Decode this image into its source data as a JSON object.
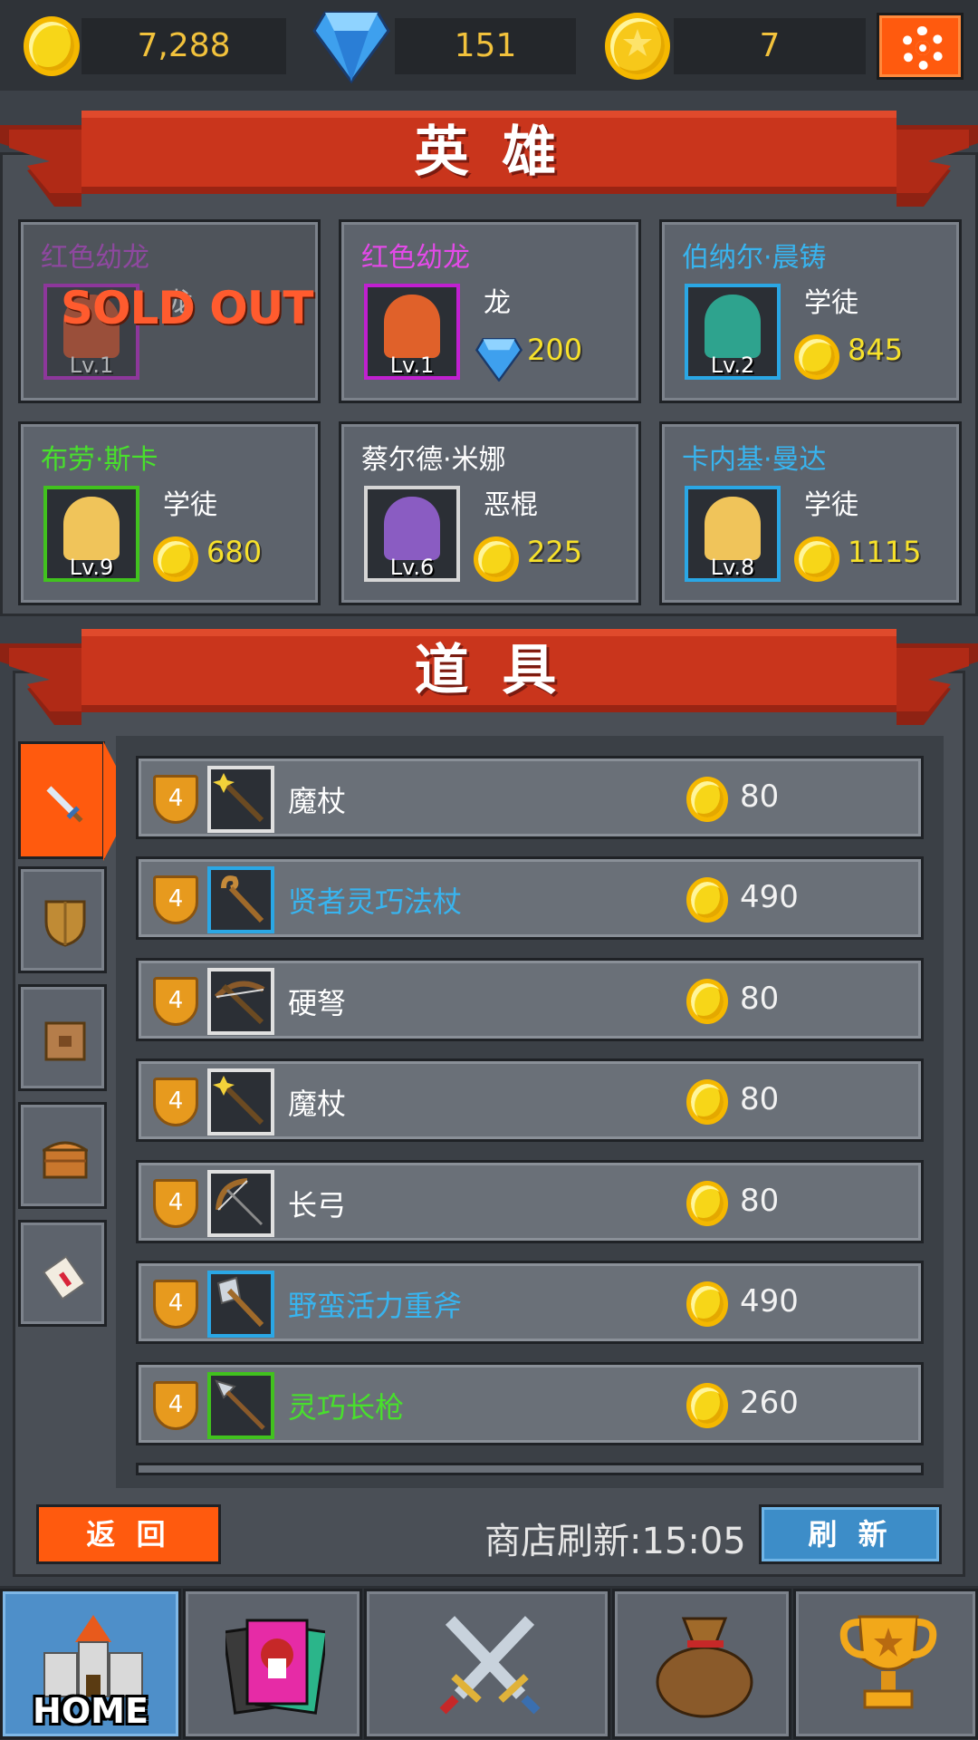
{
  "resources": {
    "gold": "7,288",
    "gems": "151",
    "medals": "7"
  },
  "sections": {
    "heroes_title": "英 雄",
    "items_title": "道 具"
  },
  "heroes": [
    {
      "name": "红色幼龙",
      "name_color": "#c23fd8",
      "class": "龙",
      "level": "Lv.1",
      "currency": "gem",
      "price": "",
      "sold_out": true,
      "sold_out_label": "SOLD OUT",
      "frame": "#c020d0",
      "art": "#d84c20"
    },
    {
      "name": "红色幼龙",
      "name_color": "#e34ae8",
      "class": "龙",
      "level": "Lv.1",
      "currency": "gem",
      "price": "200",
      "sold_out": false,
      "frame": "#c020d0",
      "art": "#e0612a"
    },
    {
      "name": "伯纳尔·晨铸",
      "name_color": "#38b4ef",
      "class": "学徒",
      "level": "Lv.2",
      "currency": "gold",
      "price": "845",
      "sold_out": false,
      "frame": "#2aa7e5",
      "art": "#2ea38e"
    },
    {
      "name": "布劳·斯卡",
      "name_color": "#48e02c",
      "class": "学徒",
      "level": "Lv.9",
      "currency": "gold",
      "price": "680",
      "sold_out": false,
      "frame": "#41c21e",
      "art": "#f0c45a"
    },
    {
      "name": "蔡尔德·米娜",
      "name_color": "#ffffff",
      "class": "恶棍",
      "level": "Lv.6",
      "currency": "gold",
      "price": "225",
      "sold_out": false,
      "frame": "#d6d6d6",
      "art": "#8a5cc2"
    },
    {
      "name": "卡内基·曼达",
      "name_color": "#38b4ef",
      "class": "学徒",
      "level": "Lv.8",
      "currency": "gold",
      "price": "1115",
      "sold_out": false,
      "frame": "#2aa7e5",
      "art": "#f0c45a"
    }
  ],
  "items": [
    {
      "tier": "4",
      "name": "魔杖",
      "name_color": "#ffffff",
      "frame": "#e0e0e0",
      "icon": "wand-icon",
      "price": "80"
    },
    {
      "tier": "4",
      "name": "贤者灵巧法杖",
      "name_color": "#38b4ef",
      "frame": "#2aa7e5",
      "icon": "staff-icon",
      "price": "490"
    },
    {
      "tier": "4",
      "name": "硬弩",
      "name_color": "#ffffff",
      "frame": "#e0e0e0",
      "icon": "crossbow-icon",
      "price": "80"
    },
    {
      "tier": "4",
      "name": "魔杖",
      "name_color": "#ffffff",
      "frame": "#e0e0e0",
      "icon": "wand-icon",
      "price": "80"
    },
    {
      "tier": "4",
      "name": "长弓",
      "name_color": "#ffffff",
      "frame": "#e0e0e0",
      "icon": "bow-icon",
      "price": "80"
    },
    {
      "tier": "4",
      "name": "野蛮活力重斧",
      "name_color": "#38b4ef",
      "frame": "#2aa7e5",
      "icon": "axe-icon",
      "price": "490"
    },
    {
      "tier": "4",
      "name": "灵巧长枪",
      "name_color": "#48e02c",
      "frame": "#41c21e",
      "icon": "spear-icon",
      "price": "260"
    }
  ],
  "category_tabs": [
    "sword-icon",
    "shield-icon",
    "box-icon",
    "chest-icon",
    "scroll-icon"
  ],
  "controls": {
    "back_label": "返 回",
    "refresh_label": "刷 新",
    "refresh_timer": "商店刷新:15:05"
  },
  "nav": {
    "home_label": "HOME",
    "items": [
      "castle-icon",
      "hero-cards-icon",
      "crossed-swords-icon",
      "loot-bag-icon",
      "trophy-icon"
    ]
  },
  "colors": {
    "accent": "#ff5a0e",
    "banner": "#c9351c",
    "refresh": "#3d8dc8",
    "gold_text": "#f7e12a"
  }
}
